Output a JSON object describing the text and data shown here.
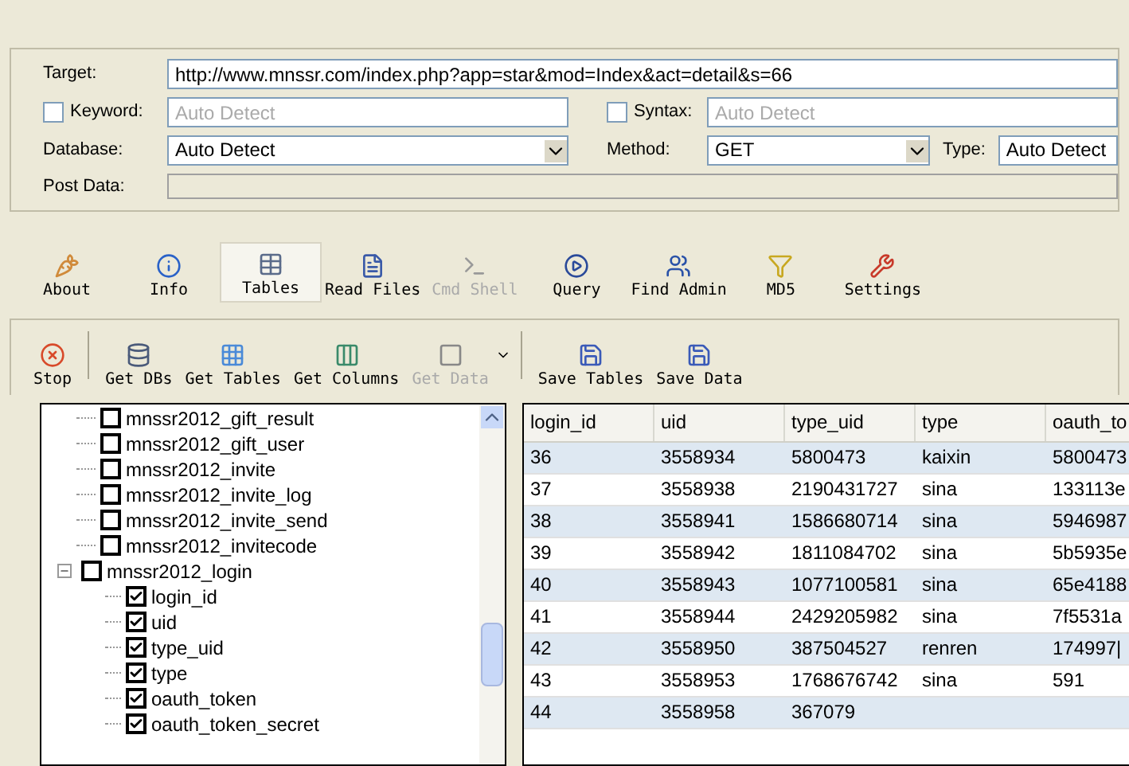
{
  "form": {
    "target_label": "Target:",
    "target": "http://www.mnssr.com/index.php?app=star&mod=Index&act=detail&s=66",
    "keyword": {
      "label": "Keyword:",
      "checked": false,
      "placeholder": "Auto Detect"
    },
    "syntax": {
      "label": "Syntax:",
      "checked": false,
      "placeholder": "Auto Detect"
    },
    "database_label": "Database:",
    "database": "Auto Detect",
    "method_label": "Method:",
    "method": "GET",
    "type_label": "Type:",
    "type": "Auto Detect",
    "post_label": "Post Data:"
  },
  "tabs": [
    {
      "label": "About",
      "selected": false,
      "disabled": false
    },
    {
      "label": "Info",
      "selected": false,
      "disabled": false
    },
    {
      "label": "Tables",
      "selected": true,
      "disabled": false
    },
    {
      "label": "Read Files",
      "selected": false,
      "disabled": false
    },
    {
      "label": "Cmd Shell",
      "selected": false,
      "disabled": true
    },
    {
      "label": "Query",
      "selected": false,
      "disabled": false
    },
    {
      "label": "Find Admin",
      "selected": false,
      "disabled": false
    },
    {
      "label": "MD5",
      "selected": false,
      "disabled": false
    },
    {
      "label": "Settings",
      "selected": false,
      "disabled": false
    }
  ],
  "actions": [
    {
      "kind": "button",
      "label": "Stop",
      "disabled": false
    },
    {
      "kind": "separator"
    },
    {
      "kind": "button",
      "label": "Get DBs",
      "disabled": false
    },
    {
      "kind": "button",
      "label": "Get Tables",
      "disabled": false
    },
    {
      "kind": "button",
      "label": "Get Columns",
      "disabled": false
    },
    {
      "kind": "button",
      "label": "Get Data",
      "disabled": true
    },
    {
      "kind": "dropdown"
    },
    {
      "kind": "separator"
    },
    {
      "kind": "button",
      "label": "Save Tables",
      "disabled": false
    },
    {
      "kind": "button",
      "label": "Save Data",
      "disabled": false
    }
  ],
  "tree": [
    {
      "label": "mnssr2012_gift_result",
      "checked": false
    },
    {
      "label": "mnssr2012_gift_user",
      "checked": false
    },
    {
      "label": "mnssr2012_invite",
      "checked": false
    },
    {
      "label": "mnssr2012_invite_log",
      "checked": false
    },
    {
      "label": "mnssr2012_invite_send",
      "checked": false
    },
    {
      "label": "mnssr2012_invitecode",
      "checked": false
    },
    {
      "label": "mnssr2012_login",
      "checked": false,
      "expanded": true,
      "children": [
        {
          "label": "login_id",
          "checked": true
        },
        {
          "label": "uid",
          "checked": true
        },
        {
          "label": "type_uid",
          "checked": true
        },
        {
          "label": "type",
          "checked": true
        },
        {
          "label": "oauth_token",
          "checked": true
        },
        {
          "label": "oauth_token_secret",
          "checked": true
        }
      ]
    }
  ],
  "table": {
    "columns": [
      "login_id",
      "uid",
      "type_uid",
      "type",
      "oauth_to"
    ],
    "rows": [
      [
        "36",
        "3558934",
        "5800473",
        "kaixin",
        "5800473"
      ],
      [
        "37",
        "3558938",
        "2190431727",
        "sina",
        "133113e"
      ],
      [
        "38",
        "3558941",
        "1586680714",
        "sina",
        "5946987"
      ],
      [
        "39",
        "3558942",
        "1811084702",
        "sina",
        "5b5935e"
      ],
      [
        "40",
        "3558943",
        "1077100581",
        "sina",
        "65e4188"
      ],
      [
        "41",
        "3558944",
        "2429205982",
        "sina",
        "7f5531a"
      ],
      [
        "42",
        "3558950",
        "387504527",
        "renren",
        "174997|"
      ],
      [
        "43",
        "3558953",
        "1768676742",
        "sina",
        "591"
      ],
      [
        "44",
        "3558958",
        "367079"
      ]
    ]
  }
}
